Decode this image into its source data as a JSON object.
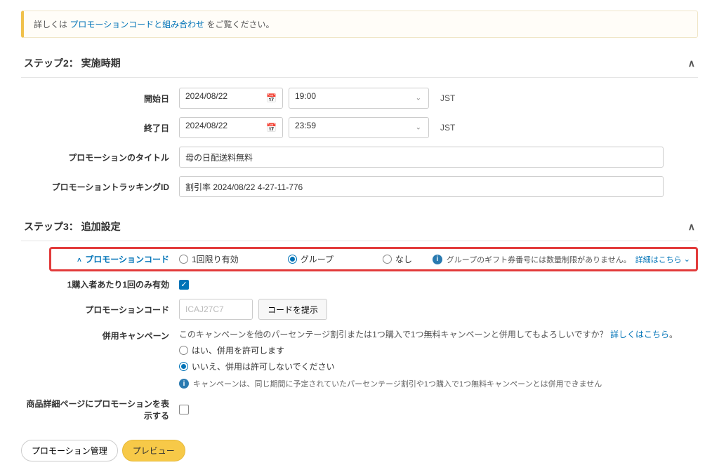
{
  "info_bar": {
    "prefix": "詳しくは ",
    "link": "プロモーションコードと組み合わせ",
    "suffix": " をご覧ください。"
  },
  "step2": {
    "title": "ステップ2： 実施時期",
    "start_label": "開始日",
    "start_date": "2024/08/22",
    "start_time": "19:00",
    "end_label": "終了日",
    "end_date": "2024/08/22",
    "end_time": "23:59",
    "tz": "JST",
    "promo_title_label": "プロモーションのタイトル",
    "promo_title_value": "母の日配送料無料",
    "tracking_label": "プロモーショントラッキングID",
    "tracking_value": "割引率 2024/08/22 4-27-11-776"
  },
  "step3": {
    "title": "ステップ3： 追加設定",
    "promo_code_label": "プロモーションコード",
    "radio_once": "1回限り有効",
    "radio_group": "グループ",
    "radio_none": "なし",
    "info_text": "グループのギフト券番号には数量制限がありません。",
    "detail_link": "詳細はこちら",
    "one_per_buyer_label": "1購入者あたり1回のみ有効",
    "code_label": "プロモーションコード",
    "code_value": "ICAJ27C7",
    "suggest_btn": "コードを提示",
    "combine_label": "併用キャンペーン",
    "combine_text": "このキャンペーンを他のパーセンテージ割引または1つ購入で1つ無料キャンペーンと併用してもよろしいですか？ ",
    "combine_link": "詳しくはこちら",
    "combine_suffix": "。",
    "radio_yes": "はい、併用を許可します",
    "radio_no": "いいえ、併用は許可しないでください",
    "combine_note": "キャンペーンは、同じ期間に予定されていたパーセンテージ割引や1つ購入で1つ無料キャンペーンとは併用できません",
    "display_label": "商品詳細ページにプロモーションを表示する"
  },
  "buttons": {
    "manage": "プロモーション管理",
    "preview": "プレビュー"
  }
}
